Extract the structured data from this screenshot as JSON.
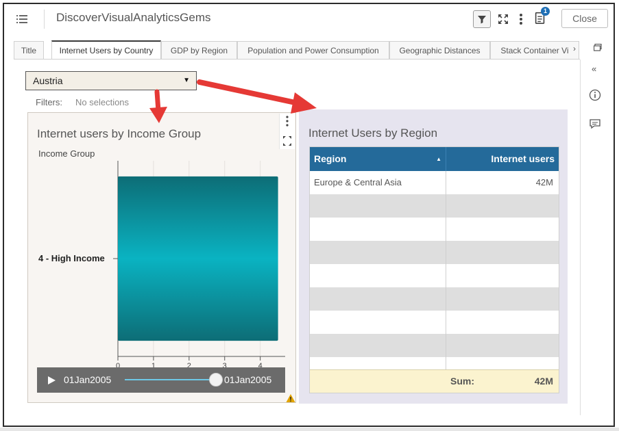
{
  "header": {
    "title": "DiscoverVisualAnalyticsGems",
    "notification_count": "1",
    "close_label": "Close"
  },
  "tabs": [
    {
      "label": "Title"
    },
    {
      "label": "Internet Users by Country"
    },
    {
      "label": "GDP by Region"
    },
    {
      "label": "Population and Power Consumption"
    },
    {
      "label": "Geographic Distances"
    },
    {
      "label": "Stack Container Vi"
    }
  ],
  "tab_scroll": "›",
  "sidepanel": {
    "collapse": "«"
  },
  "country_select": {
    "value": "Austria"
  },
  "filters": {
    "label": "Filters:",
    "value": "No selections"
  },
  "left_panel": {
    "title": "Internet users by Income Group",
    "ylabel": "Income Group",
    "slider_start": "01Jan2005",
    "slider_end": "01Jan2005"
  },
  "chart_data": {
    "type": "bar",
    "orientation": "horizontal",
    "categories": [
      "4 - High Income"
    ],
    "values": [
      4.5
    ],
    "ylabel": "Income Group",
    "xticks": [
      "0",
      "1",
      "2",
      "3",
      "4"
    ],
    "xlim": [
      0,
      4.7
    ],
    "grid": true,
    "color": "#0a9aa8"
  },
  "right_panel": {
    "title": "Internet Users by Region",
    "col_region": "Region",
    "col_users": "Internet users",
    "rows": [
      {
        "region": "Europe & Central Asia",
        "users": "42M"
      }
    ],
    "sum_label": "Sum:",
    "sum_value": "42M"
  },
  "colors": {
    "table_header": "#246a9a",
    "bar": "#0a9aa8",
    "arrow": "#e53935",
    "footer": "#fbf3cf"
  }
}
